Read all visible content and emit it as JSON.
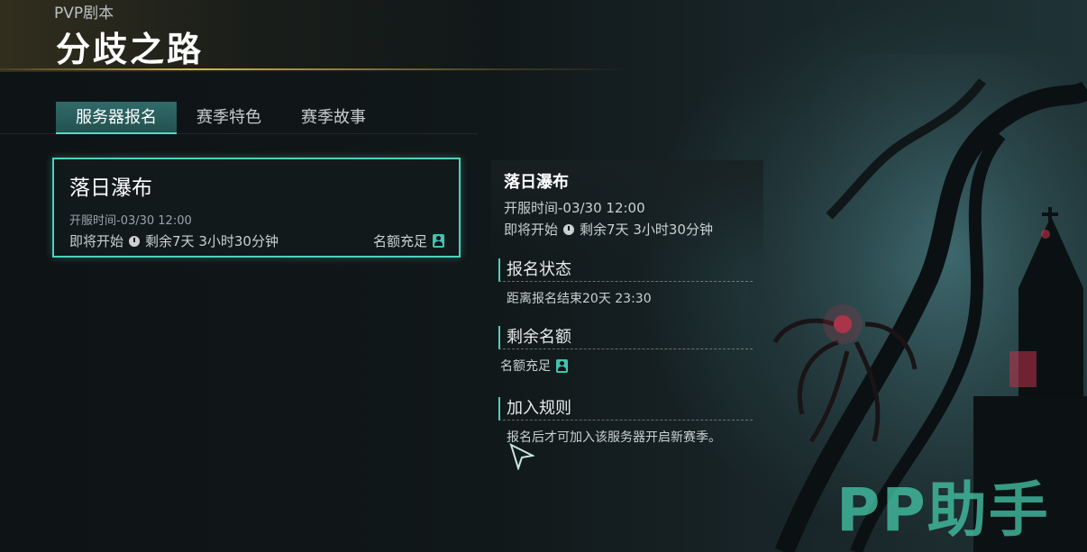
{
  "header": {
    "mode_label": "PVP剧本",
    "title": "分歧之路"
  },
  "tabs": [
    {
      "label": "服务器报名",
      "active": true
    },
    {
      "label": "赛季特色",
      "active": false
    },
    {
      "label": "赛季故事",
      "active": false
    }
  ],
  "server_card": {
    "name": "落日瀑布",
    "open_time": "开服时间-03/30 12:00",
    "status": "即将开始",
    "remaining": "剩余7天 3小时30分钟",
    "quota": "名额充足",
    "clock_icon": "clock-icon",
    "quota_icon": "person-icon"
  },
  "detail": {
    "name": "落日瀑布",
    "open_time": "开服时间-03/30 12:00",
    "status": "即将开始",
    "remaining": "剩余7天 3小时30分钟",
    "sections": {
      "signup": {
        "title": "报名状态",
        "body": "距离报名结束20天 23:30"
      },
      "quota": {
        "title": "剩余名额",
        "body": "名额充足"
      },
      "rules": {
        "title": "加入规则",
        "body": "报名后才可加入该服务器开启新赛季。"
      }
    }
  },
  "watermark": "PP助手",
  "colors": {
    "accent": "#4fd0bd",
    "gold": "#f0c850",
    "tab_active": "#2f6b6a"
  }
}
